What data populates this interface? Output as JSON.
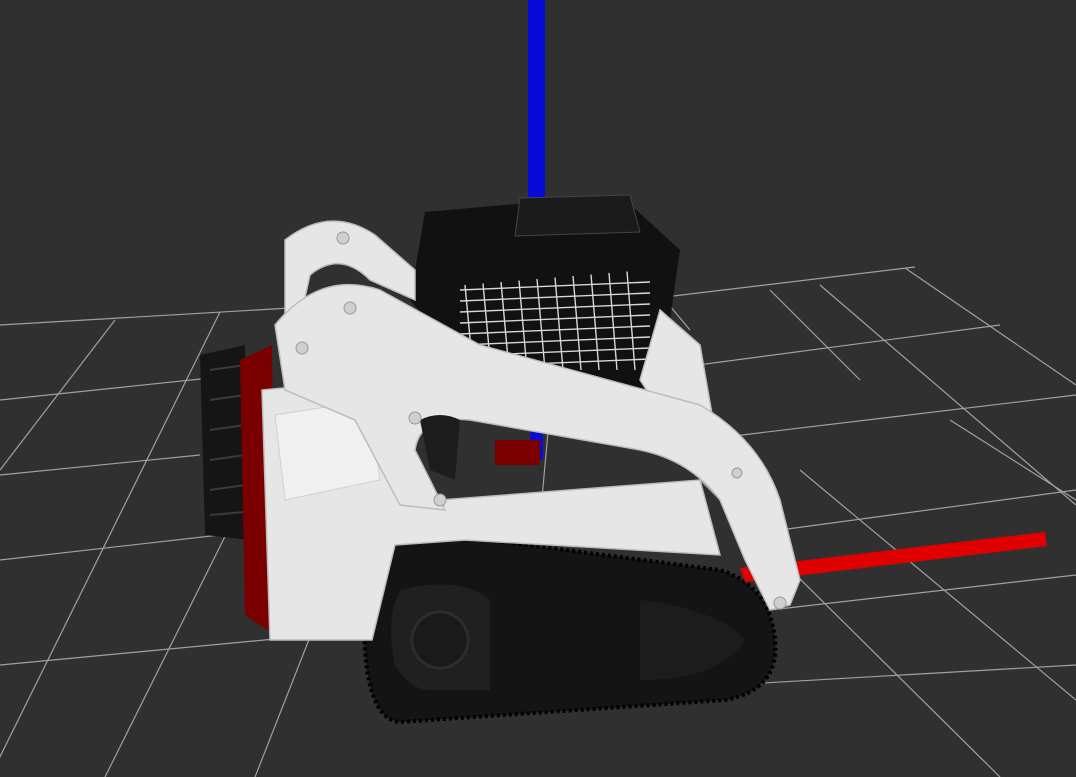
{
  "viewport": {
    "background_color": "#303030",
    "grid_color": "#a0a0a0",
    "grid_visible": true
  },
  "axes": {
    "z_axis_color": "#0a0ad8",
    "x_axis_color": "#e00000"
  },
  "robot_model": {
    "body_color": "#e6e6e6",
    "track_color": "#141414",
    "cab_color": "#111111",
    "accent_color": "#7a0000"
  }
}
